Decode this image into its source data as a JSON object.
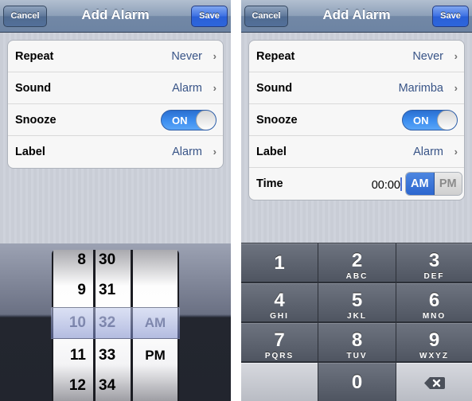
{
  "screens": {
    "left": {
      "navbar": {
        "title": "Add Alarm",
        "cancel_label": "Cancel",
        "save_label": "Save"
      },
      "settings": {
        "repeat": {
          "label": "Repeat",
          "value": "Never"
        },
        "sound": {
          "label": "Sound",
          "value": "Alarm"
        },
        "snooze": {
          "label": "Snooze",
          "toggle": "ON",
          "on": true
        },
        "label": {
          "label": "Label",
          "value": "Alarm"
        }
      },
      "picker": {
        "hours": [
          "8",
          "9",
          "10",
          "11",
          "12"
        ],
        "minutes": [
          "30",
          "31",
          "32",
          "33",
          "34"
        ],
        "periods": [
          "AM",
          "PM"
        ],
        "selected": {
          "hour": "10",
          "minute": "32",
          "period": "AM"
        }
      }
    },
    "right": {
      "navbar": {
        "title": "Add Alarm",
        "cancel_label": "Cancel",
        "save_label": "Save"
      },
      "settings": {
        "repeat": {
          "label": "Repeat",
          "value": "Never"
        },
        "sound": {
          "label": "Sound",
          "value": "Marimba"
        },
        "snooze": {
          "label": "Snooze",
          "toggle": "ON",
          "on": true
        },
        "label": {
          "label": "Label",
          "value": "Alarm"
        },
        "time": {
          "label": "Time",
          "value": "00:00",
          "am_label": "AM",
          "pm_label": "PM",
          "selected": "AM"
        }
      },
      "keypad": {
        "keys": [
          {
            "num": "1",
            "letters": ""
          },
          {
            "num": "2",
            "letters": "ABC"
          },
          {
            "num": "3",
            "letters": "DEF"
          },
          {
            "num": "4",
            "letters": "GHI"
          },
          {
            "num": "5",
            "letters": "JKL"
          },
          {
            "num": "6",
            "letters": "MNO"
          },
          {
            "num": "7",
            "letters": "PQRS"
          },
          {
            "num": "8",
            "letters": "TUV"
          },
          {
            "num": "9",
            "letters": "WXYZ"
          },
          {
            "num": "0",
            "letters": ""
          }
        ],
        "delete_icon": "backspace-icon"
      }
    }
  },
  "icons": {
    "chevron": "›"
  }
}
